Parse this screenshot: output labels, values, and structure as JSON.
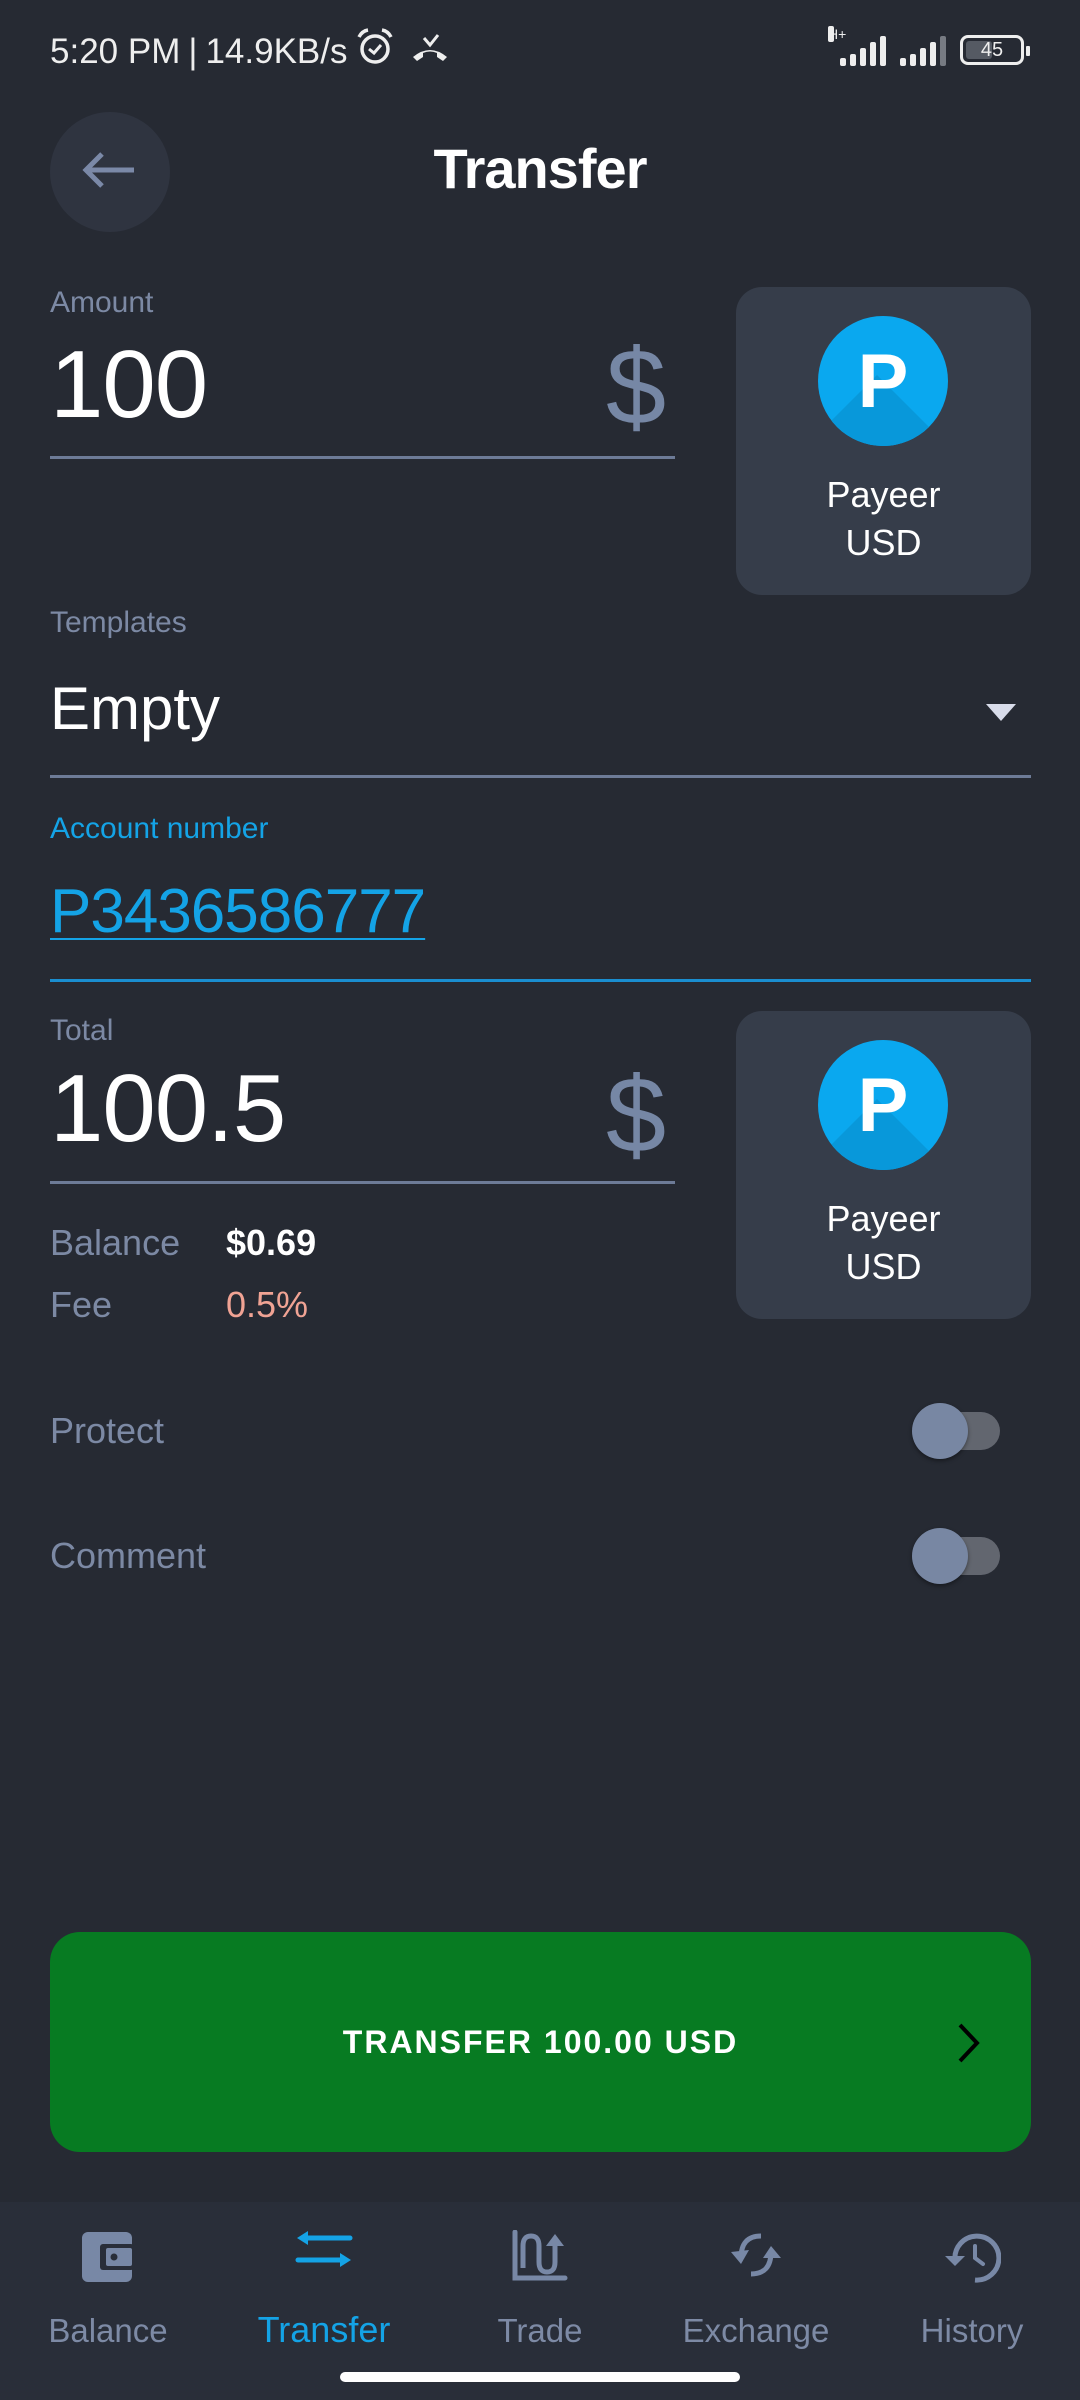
{
  "status_bar": {
    "time": "5:20 PM",
    "separator": "|",
    "network_speed": "14.9KB/s",
    "network_type": "H+",
    "battery_level": "45",
    "icons": [
      "alarm-icon",
      "missed-call-icon",
      "signal-icon",
      "signal-icon-2",
      "battery-icon"
    ]
  },
  "header": {
    "title": "Transfer",
    "back_icon": "arrow-left-icon"
  },
  "amount": {
    "label": "Amount",
    "value": "100",
    "currency_symbol": "$"
  },
  "source_wallet": {
    "logo_letter": "P",
    "name": "Payeer",
    "currency": "USD"
  },
  "templates": {
    "label": "Templates",
    "selected": "Empty"
  },
  "account_number": {
    "label": "Account number",
    "value": "P3436586777"
  },
  "total": {
    "label": "Total",
    "value": "100.5",
    "currency_symbol": "$"
  },
  "target_wallet": {
    "logo_letter": "P",
    "name": "Payeer",
    "currency": "USD"
  },
  "info": {
    "balance_label": "Balance",
    "balance_value": "$0.69",
    "fee_label": "Fee",
    "fee_value": "0.5%"
  },
  "options": {
    "protect_label": "Protect",
    "protect_on": false,
    "comment_label": "Comment",
    "comment_on": false
  },
  "action": {
    "transfer_label": "TRANSFER 100.00 USD"
  },
  "bottom_nav": {
    "items": [
      {
        "label": "Balance",
        "icon": "wallet-icon",
        "active": false
      },
      {
        "label": "Transfer",
        "icon": "transfer-arrows-icon",
        "active": true
      },
      {
        "label": "Trade",
        "icon": "trade-chart-icon",
        "active": false
      },
      {
        "label": "Exchange",
        "icon": "exchange-icon",
        "active": false
      },
      {
        "label": "History",
        "icon": "history-icon",
        "active": false
      }
    ]
  },
  "colors": {
    "background": "#262a33",
    "accent": "#14a3e6",
    "muted": "#7c89a4",
    "fee": "#f0a394",
    "button_green": "#077b22",
    "card": "#363d4a",
    "payeer_blue": "#0aa8ef"
  }
}
